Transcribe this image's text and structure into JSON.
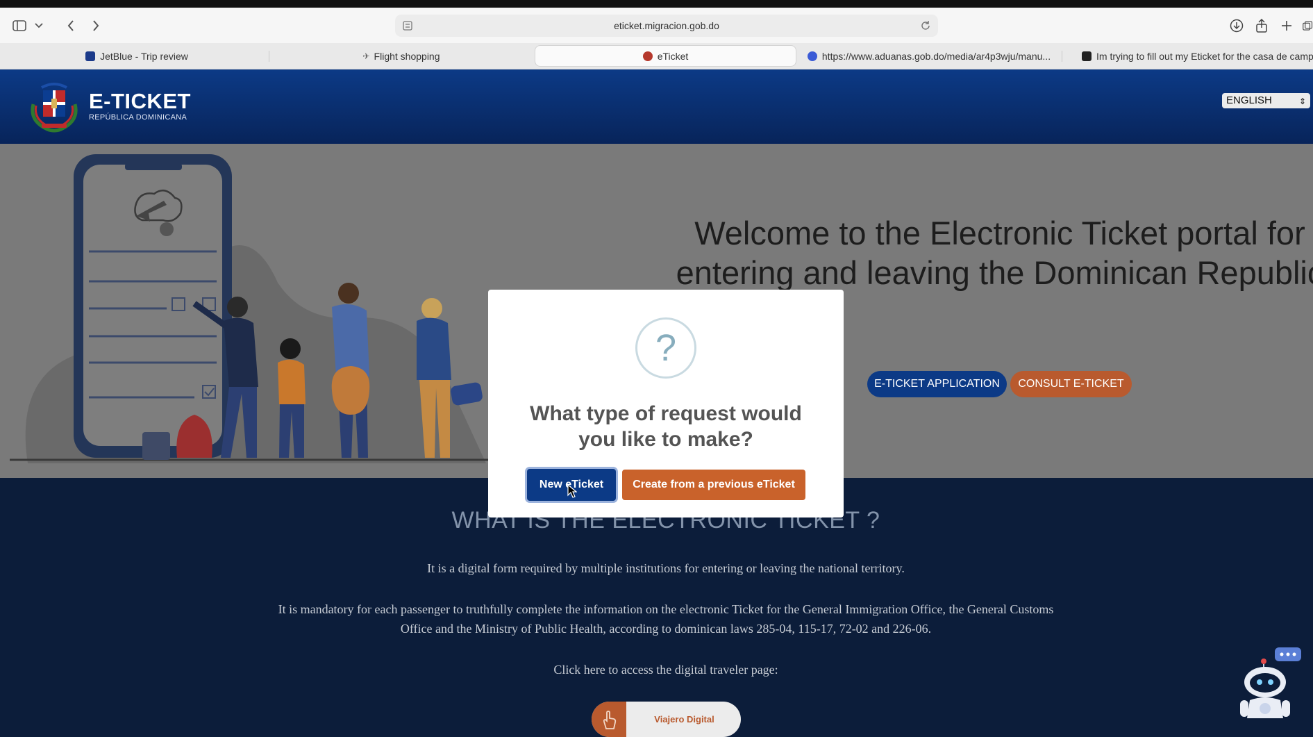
{
  "browser": {
    "url": "eticket.migracion.gob.do",
    "tabs": [
      {
        "label": "JetBlue - Trip review",
        "fav_color": "#1b3a8a"
      },
      {
        "label": "Flight shopping",
        "fav_color": "#666666"
      },
      {
        "label": "eTicket",
        "fav_color": "#b5382c",
        "active": true
      },
      {
        "label": "https://www.aduanas.gob.do/media/ar4p3wju/manu...",
        "fav_color": "#3b5bd6"
      },
      {
        "label": "Im trying to fill out my Eticket for the casa de camp...",
        "fav_color": "#222222"
      }
    ]
  },
  "header": {
    "brand_title": "E-TICKET",
    "brand_subtitle": "REPÚBLICA DOMINICANA",
    "language": "ENGLISH"
  },
  "hero": {
    "title": "Welcome to the Electronic Ticket portal for entering and leaving the Dominican Republic",
    "btn_application": "E-TICKET APPLICATION",
    "btn_consult": "CONSULT E-TICKET"
  },
  "info": {
    "title": "WHAT IS THE ELECTRONIC TICKET ?",
    "p1": "It is a digital form required by multiple institutions for entering or leaving the national territory.",
    "p2": "It is mandatory for each passenger to truthfully complete the information on the electronic Ticket for the General Immigration Office, the General Customs Office and the Ministry of Public Health, according to dominican laws 285-04, 115-17, 72-02 and 226-06.",
    "p3": "Click here to access the digital traveler page:",
    "viajero_label": "Viajero Digital"
  },
  "modal": {
    "icon": "?",
    "title": "What type of request would you like to make?",
    "btn_new": "New eTicket",
    "btn_previous": "Create from a previous eTicket"
  },
  "colors": {
    "header_blue": "#0c3a86",
    "accent_orange": "#c9622b",
    "section_dark": "#0c1d3a"
  }
}
